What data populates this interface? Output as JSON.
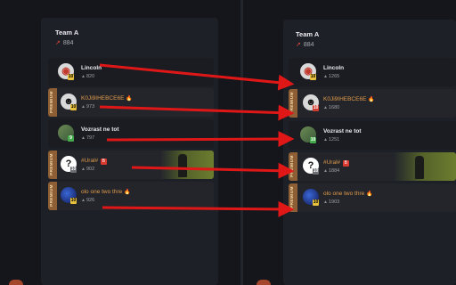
{
  "left": {
    "team_name": "Team A",
    "team_elo": "884",
    "players": [
      {
        "name": "Lincoln",
        "elo": "820",
        "premium": false
      },
      {
        "name": "K0Ji9IHEBCE6E",
        "elo": "973",
        "premium": true,
        "flame": true
      },
      {
        "name": "Vozrast ne tot",
        "elo": "797",
        "premium": false
      },
      {
        "name": "#Ural#",
        "elo": "902",
        "premium": true,
        "badge": "B"
      },
      {
        "name": "olo one two thre",
        "elo": "926",
        "premium": true,
        "flame": true
      }
    ]
  },
  "right": {
    "team_name": "Team A",
    "team_elo": "884",
    "players": [
      {
        "name": "Lincoln",
        "elo": "1265",
        "premium": false
      },
      {
        "name": "K0Ji9IHEBCE6E",
        "elo": "1680",
        "premium": true,
        "flame": true
      },
      {
        "name": "Vozrast ne tot",
        "elo": "1251",
        "premium": false
      },
      {
        "name": "#Ural#",
        "elo": "1884",
        "premium": true,
        "badge": "B"
      },
      {
        "name": "olo one two thre",
        "elo": "1903",
        "premium": true,
        "flame": true
      }
    ]
  },
  "premium_label": "PREMIUM",
  "icons": {
    "trend": "trend-up-icon",
    "elo": "elo-icon",
    "flame": "flame-icon"
  },
  "colors": {
    "arrow": "#e01717",
    "gold_name": "#e09a4a",
    "premium_tag": "#8e5f35"
  }
}
